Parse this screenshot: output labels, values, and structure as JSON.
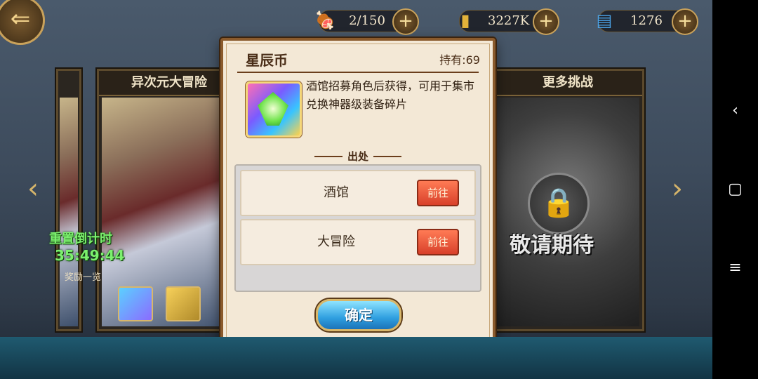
{
  "resources": [
    {
      "icon": "meat-icon",
      "value": "2/150"
    },
    {
      "icon": "gold-icon",
      "value": "3227K"
    },
    {
      "icon": "book-icon",
      "value": "1276"
    }
  ],
  "left_card": {
    "title": "异次元大冒险",
    "timer_label": "重置倒计时",
    "timer_value": "35:49:44",
    "reward_label": "奖励一览"
  },
  "right_card": {
    "title": "更多挑战",
    "locked_text": "敬请期待"
  },
  "dialog": {
    "title": "星辰币",
    "owned": "持有:69",
    "description": "酒馆招募角色后获得，可用于集市兑换神器级装备碎片",
    "source_header": "出处",
    "sources": [
      {
        "name": "酒馆",
        "button": "前往"
      },
      {
        "name": "大冒险",
        "button": "前往"
      }
    ],
    "confirm": "确定"
  },
  "navbar": {
    "back": "‹",
    "home": "▢",
    "menu": "≡"
  },
  "colors": {
    "dialog_bg": "#f3e8d6",
    "go_button": "#d8402a",
    "confirm_button": "#2f9fe0",
    "timer_text": "#7cf06e"
  }
}
